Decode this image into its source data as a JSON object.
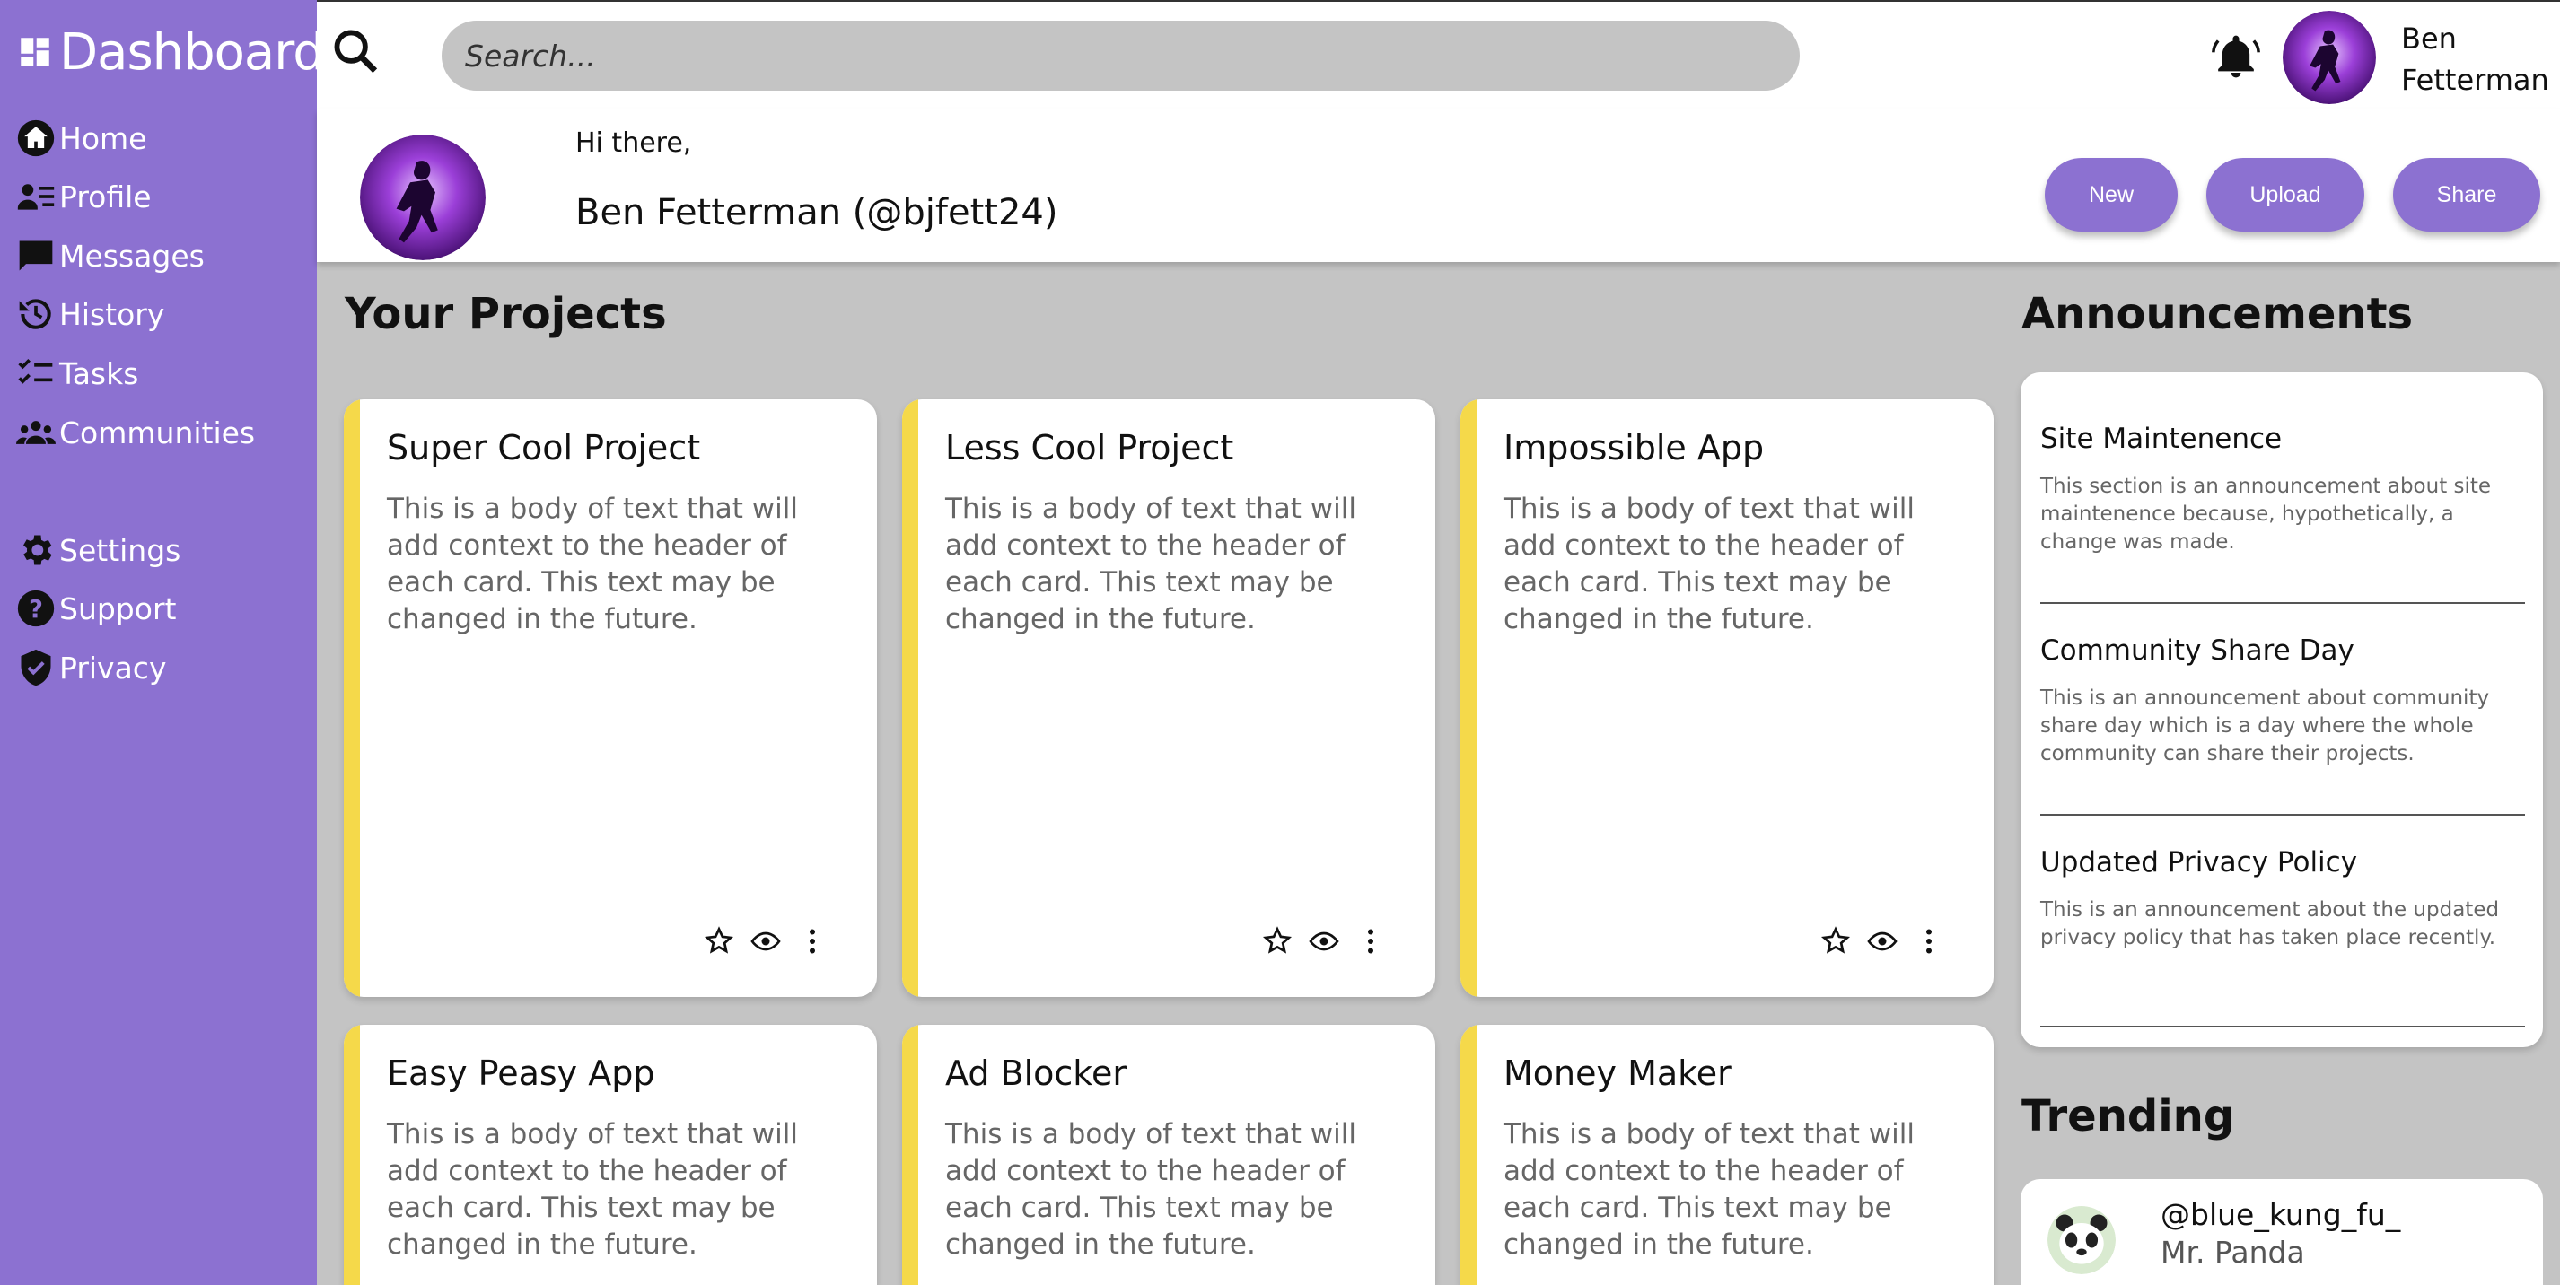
{
  "sidebar": {
    "title": "Dashboard",
    "items": [
      {
        "label": "Home",
        "icon": "home-icon"
      },
      {
        "label": "Profile",
        "icon": "profile-icon"
      },
      {
        "label": "Messages",
        "icon": "messages-icon"
      },
      {
        "label": "History",
        "icon": "history-icon"
      },
      {
        "label": "Tasks",
        "icon": "tasks-icon"
      },
      {
        "label": "Communities",
        "icon": "communities-icon"
      },
      {
        "label": "Settings",
        "icon": "gear-icon"
      },
      {
        "label": "Support",
        "icon": "help-icon"
      },
      {
        "label": "Privacy",
        "icon": "shield-icon"
      }
    ]
  },
  "header": {
    "search_placeholder": "Search...",
    "user_name": "Ben Fetterman"
  },
  "welcome": {
    "greeting": "Hi there,",
    "full_name": "Ben Fetterman (@bjfett24)",
    "buttons": {
      "new": "New",
      "upload": "Upload",
      "share": "Share"
    }
  },
  "projects": {
    "title": "Your Projects",
    "cards": [
      {
        "title": "Super Cool Project",
        "body": "This is a body of text that will add context to the header of each card. This text may be changed in the future."
      },
      {
        "title": "Less Cool Project",
        "body": "This is a body of text that will add context to the header of each card. This text may be changed in the future."
      },
      {
        "title": "Impossible App",
        "body": "This is a body of text that will add context to the header of each card. This text may be changed in the future."
      },
      {
        "title": "Easy Peasy App",
        "body": "This is a body of text that will add context to the header of each card. This text may be changed in the future."
      },
      {
        "title": "Ad Blocker",
        "body": "This is a body of text that will add context to the header of each card. This text may be changed in the future."
      },
      {
        "title": "Money Maker",
        "body": "This is a body of text that will add context to the header of each card. This text may be changed in the future."
      }
    ]
  },
  "announcements": {
    "title": "Announcements",
    "items": [
      {
        "title": "Site Maintenence",
        "text": "This section is an announcement about site maintenence because, hypothetically, a change was made."
      },
      {
        "title": "Community Share Day",
        "text": "This is an announcement about community share day which is a day where the whole community can share their projects."
      },
      {
        "title": "Updated Privacy Policy",
        "text": "This is an announcement about the updated privacy policy that has taken place recently."
      }
    ]
  },
  "trending": {
    "title": "Trending",
    "items": [
      {
        "handle": "@blue_kung_fu_",
        "name": "Mr. Panda"
      }
    ]
  },
  "colors": {
    "accent": "#8c71d1",
    "card_stripe": "#f5d94a",
    "background": "#c4c4c4"
  }
}
